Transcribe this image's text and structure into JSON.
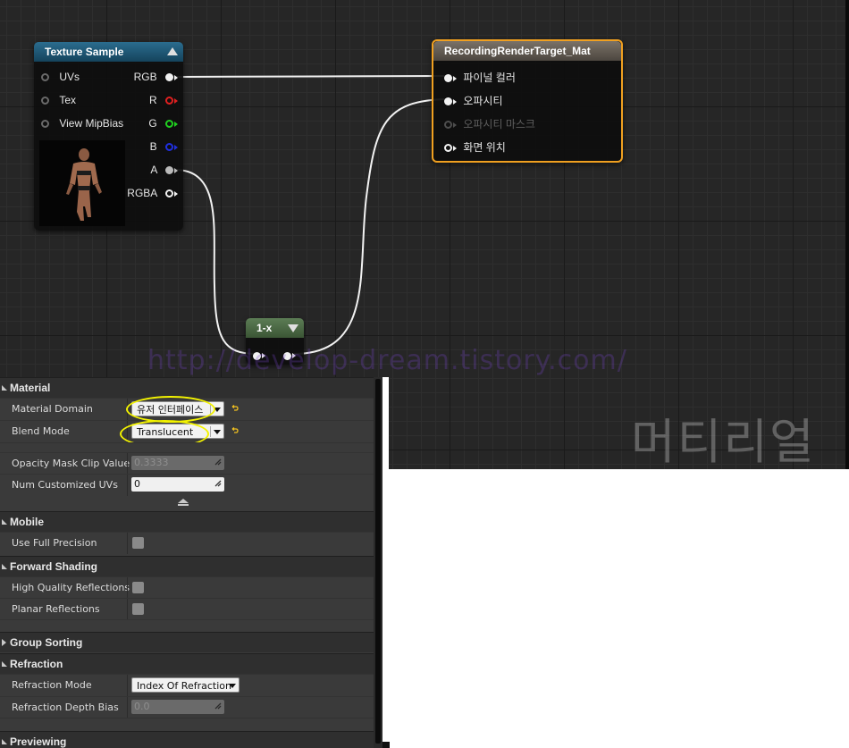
{
  "graph": {
    "watermark": "http://develop-dream.tistory.com/",
    "overlay_label": "머티리얼",
    "nodes": {
      "texture_sample": {
        "title": "Texture Sample",
        "header_color": "#1f5a78",
        "inputs": [
          "UVs",
          "Tex",
          "View MipBias"
        ],
        "outputs": [
          {
            "label": "RGB",
            "color": "#f2f2f2"
          },
          {
            "label": "R",
            "color": "#e02020"
          },
          {
            "label": "G",
            "color": "#20d020"
          },
          {
            "label": "B",
            "color": "#2030e0"
          },
          {
            "label": "A",
            "color": "#bbbbbb"
          },
          {
            "label": "RGBA",
            "color": "#f2f2f2"
          }
        ]
      },
      "one_minus": {
        "title": "1-x",
        "header_color": "#4d6b47"
      },
      "result": {
        "title": "RecordingRenderTarget_Mat",
        "header_color": "#6b6258",
        "border_color": "#f0a020",
        "inputs": [
          "파이널 컬러",
          "오파시티",
          "오파시티 마스크",
          "화면 위치"
        ]
      }
    }
  },
  "details": {
    "material": {
      "title": "Material",
      "material_domain_label": "Material Domain",
      "material_domain_value": "유저 인터페이스",
      "blend_mode_label": "Blend Mode",
      "blend_mode_value": "Translucent",
      "opacity_mask_label": "Opacity Mask Clip Value",
      "opacity_mask_value": "0.3333",
      "num_uvs_label": "Num Customized UVs",
      "num_uvs_value": "0"
    },
    "mobile": {
      "title": "Mobile",
      "use_full_precision_label": "Use Full Precision"
    },
    "forward_shading": {
      "title": "Forward Shading",
      "hq_reflections_label": "High Quality Reflections",
      "planar_reflections_label": "Planar Reflections"
    },
    "group_sorting": {
      "title": "Group Sorting"
    },
    "refraction": {
      "title": "Refraction",
      "mode_label": "Refraction Mode",
      "mode_value": "Index Of Refraction",
      "depth_bias_label": "Refraction Depth Bias",
      "depth_bias_value": "0.0"
    },
    "previewing": {
      "title": "Previewing"
    }
  }
}
